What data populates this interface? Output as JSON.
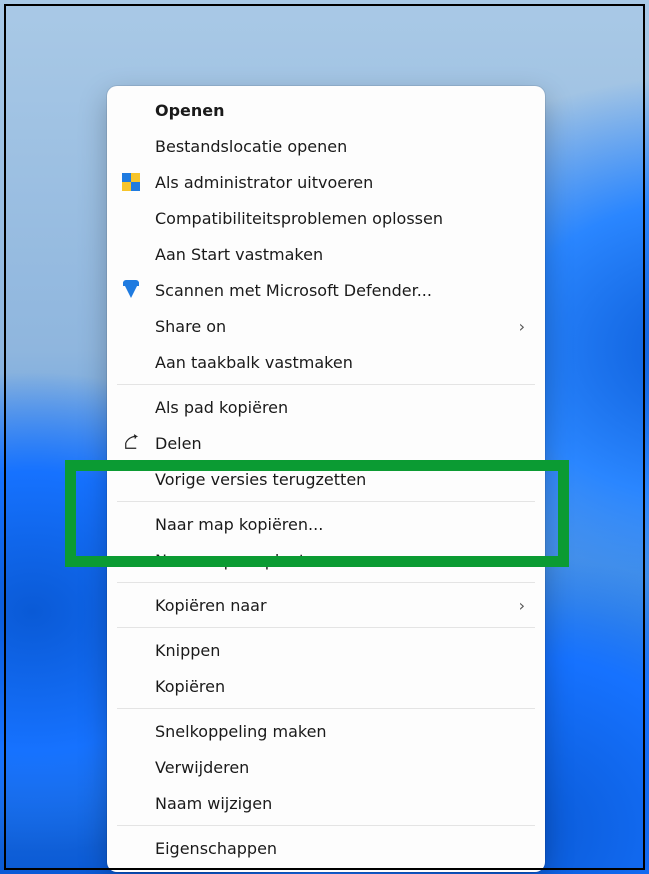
{
  "context_menu": {
    "groups": [
      [
        {
          "id": "open",
          "label": "Openen",
          "bold": true,
          "icon": null,
          "submenu": false
        },
        {
          "id": "open-file-location",
          "label": "Bestandslocatie openen",
          "bold": false,
          "icon": null,
          "submenu": false
        },
        {
          "id": "run-as-admin",
          "label": "Als administrator uitvoeren",
          "bold": false,
          "icon": "uac-shield",
          "submenu": false
        },
        {
          "id": "troubleshoot-compat",
          "label": "Compatibiliteitsproblemen oplossen",
          "bold": false,
          "icon": null,
          "submenu": false
        },
        {
          "id": "pin-to-start",
          "label": "Aan Start vastmaken",
          "bold": false,
          "icon": null,
          "submenu": false
        },
        {
          "id": "scan-defender",
          "label": "Scannen met Microsoft Defender...",
          "bold": false,
          "icon": "defender-shield",
          "submenu": false
        },
        {
          "id": "share-on",
          "label": "Share on",
          "bold": false,
          "icon": null,
          "submenu": true
        },
        {
          "id": "pin-to-taskbar",
          "label": "Aan taakbalk vastmaken",
          "bold": false,
          "icon": null,
          "submenu": false
        }
      ],
      [
        {
          "id": "copy-as-path",
          "label": "Als pad kopiëren",
          "bold": false,
          "icon": null,
          "submenu": false
        },
        {
          "id": "share",
          "label": "Delen",
          "bold": false,
          "icon": "share-icon",
          "submenu": false
        },
        {
          "id": "restore-previous",
          "label": "Vorige versies terugzetten",
          "bold": false,
          "icon": null,
          "submenu": false
        }
      ],
      [
        {
          "id": "copy-to-folder",
          "label": "Naar map kopiëren...",
          "bold": false,
          "icon": null,
          "submenu": false
        },
        {
          "id": "move-to-folder",
          "label": "Naar map verplaatsen...",
          "bold": false,
          "icon": null,
          "submenu": false
        }
      ],
      [
        {
          "id": "copy-to",
          "label": "Kopiëren naar",
          "bold": false,
          "icon": null,
          "submenu": true
        }
      ],
      [
        {
          "id": "cut",
          "label": "Knippen",
          "bold": false,
          "icon": null,
          "submenu": false
        },
        {
          "id": "copy",
          "label": "Kopiëren",
          "bold": false,
          "icon": null,
          "submenu": false
        }
      ],
      [
        {
          "id": "create-shortcut",
          "label": "Snelkoppeling maken",
          "bold": false,
          "icon": null,
          "submenu": false
        },
        {
          "id": "delete",
          "label": "Verwijderen",
          "bold": false,
          "icon": null,
          "submenu": false
        },
        {
          "id": "rename",
          "label": "Naam wijzigen",
          "bold": false,
          "icon": null,
          "submenu": false
        }
      ],
      [
        {
          "id": "properties",
          "label": "Eigenschappen",
          "bold": false,
          "icon": null,
          "submenu": false
        }
      ]
    ]
  },
  "highlight": {
    "group_index": 2,
    "color": "#0b9b33"
  }
}
